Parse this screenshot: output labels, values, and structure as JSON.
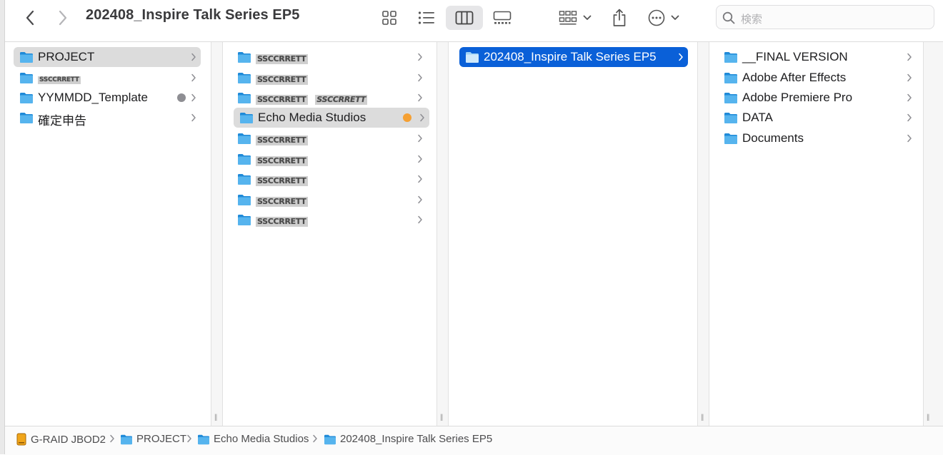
{
  "window": {
    "title": "202408_Inspire Talk Series EP5"
  },
  "search": {
    "placeholder": "検索"
  },
  "colors": {
    "accent": "#0a60d8",
    "folder": "#3ea2e6",
    "tag_gray": "#8e8e93",
    "tag_orange": "#f5a033"
  },
  "column1": {
    "items": [
      {
        "label": "PROJECT",
        "selected": true
      },
      {
        "label": "SSCCRRETT",
        "redacted": true
      },
      {
        "label": "YYMMDD_Template",
        "tag": "gray"
      },
      {
        "label": "確定申告"
      }
    ]
  },
  "column2": {
    "items": [
      {
        "label": "SSCCRRETT",
        "redacted": true
      },
      {
        "label": "SSCCRRETT",
        "redacted": true
      },
      {
        "label": "SSCCRRETT",
        "label2": "SSCCRRETT",
        "redacted": true
      },
      {
        "label": "Echo Media Studios",
        "selected": true,
        "tag": "orange"
      },
      {
        "label": "SSCCRRETT",
        "redacted": true
      },
      {
        "label": "SSCCRRETT",
        "redacted": true
      },
      {
        "label": "SSCCRRETT",
        "redacted": true
      },
      {
        "label": "SSCCRRETT",
        "redacted": true
      },
      {
        "label": "SSCCRRETT",
        "redacted": true
      }
    ]
  },
  "column3": {
    "items": [
      {
        "label": "202408_Inspire Talk Series EP5",
        "selected": true
      }
    ]
  },
  "column4": {
    "items": [
      {
        "label": "__FINAL VERSION"
      },
      {
        "label": "Adobe After Effects"
      },
      {
        "label": "Adobe Premiere Pro"
      },
      {
        "label": "DATA"
      },
      {
        "label": "Documents"
      }
    ]
  },
  "pathbar": {
    "crumbs": [
      {
        "label": "G-RAID JBOD2",
        "icon": "drive-icon"
      },
      {
        "label": "PROJECT",
        "icon": "folder-icon"
      },
      {
        "label": "Echo Media Studios",
        "icon": "folder-icon"
      },
      {
        "label": "202408_Inspire Talk Series EP5",
        "icon": "folder-icon"
      }
    ]
  }
}
